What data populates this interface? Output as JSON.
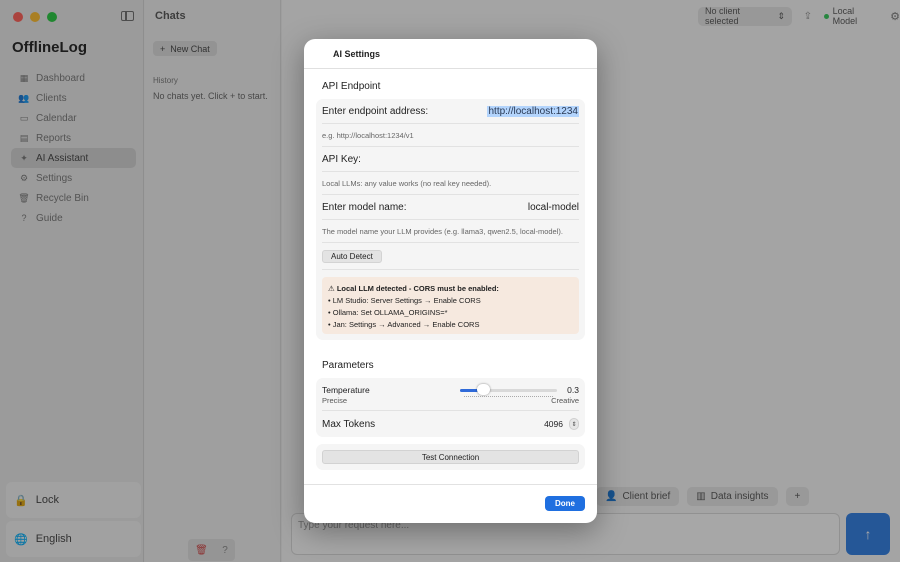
{
  "app": {
    "title": "OfflineLog",
    "nav": [
      {
        "label": "Dashboard",
        "icon": "grid-icon"
      },
      {
        "label": "Clients",
        "icon": "people-icon"
      },
      {
        "label": "Calendar",
        "icon": "calendar-icon"
      },
      {
        "label": "Reports",
        "icon": "doc-icon"
      },
      {
        "label": "AI Assistant",
        "icon": "sparkle-icon"
      },
      {
        "label": "Settings",
        "icon": "gear-icon"
      },
      {
        "label": "Recycle Bin",
        "icon": "trash-icon"
      },
      {
        "label": "Guide",
        "icon": "question-icon"
      }
    ],
    "lock_label": "Lock",
    "language_label": "English"
  },
  "chats": {
    "title": "Chats",
    "new_chat": "New Chat",
    "history_label": "History",
    "empty_text": "No chats yet. Click + to start."
  },
  "topbar": {
    "client_select": "No client selected",
    "model_badge": "Local Model"
  },
  "composer": {
    "chip_client_brief": "Client brief",
    "chip_data_insights": "Data insights",
    "placeholder": "Type your request here..."
  },
  "modal": {
    "title": "AI Settings",
    "api_section": "API Endpoint",
    "endpoint_label": "Enter endpoint address:",
    "endpoint_value": "http://localhost:1234",
    "endpoint_help": "e.g. http://localhost:1234/v1",
    "api_key_label": "API Key:",
    "api_key_help": "Local LLMs: any value works (no real key needed).",
    "model_label": "Enter model name:",
    "model_value": "local-model",
    "model_help": "The model name your LLM provides (e.g. llama3, qwen2.5, local-model).",
    "auto_detect": "Auto Detect",
    "warning_title": "Local LLM detected - CORS must be enabled:",
    "warning_lines": [
      "• LM Studio: Server Settings → Enable CORS",
      "• Ollama: Set OLLAMA_ORIGINS=*",
      "• Jan: Settings → Advanced → Enable CORS"
    ],
    "params_section": "Parameters",
    "temperature_label": "Temperature",
    "temperature_value": "0.3",
    "temperature_fraction": 0.2,
    "precise_label": "Precise",
    "creative_label": "Creative",
    "max_tokens_label": "Max Tokens",
    "max_tokens_value": "4096",
    "test_connection": "Test Connection",
    "done": "Done"
  }
}
